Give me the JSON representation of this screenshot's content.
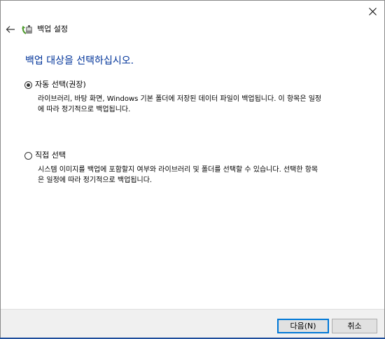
{
  "window": {
    "title": "백업 설정",
    "close_icon": "close-icon",
    "back_icon": "back-arrow-icon",
    "app_icon": "backup-settings-icon"
  },
  "main": {
    "heading": "백업 대상을 선택하십시오.",
    "options": [
      {
        "label": "자동 선택(권장)",
        "selected": true,
        "desc_line1": "라이브러리, 바탕 화면, Windows 기본 폴더에 저장된 데이터 파일이 백업됩니다. 이 항목은 일정",
        "desc_line2": "에 따라 정기적으로 백업됩니다."
      },
      {
        "label": "직접 선택",
        "selected": false,
        "desc_line1": "시스템 이미지를 백업에 포함할지 여부와 라이브러리 및 폴더를 선택할 수 있습니다. 선택한 항목",
        "desc_line2": "은 일정에 따라 정기적으로 백업됩니다."
      }
    ]
  },
  "footer": {
    "next_label": "다음(N)",
    "cancel_label": "취소"
  },
  "colors": {
    "heading": "#003399",
    "footer_bg": "#f0f0f0",
    "primary_border": "#0078d7"
  }
}
